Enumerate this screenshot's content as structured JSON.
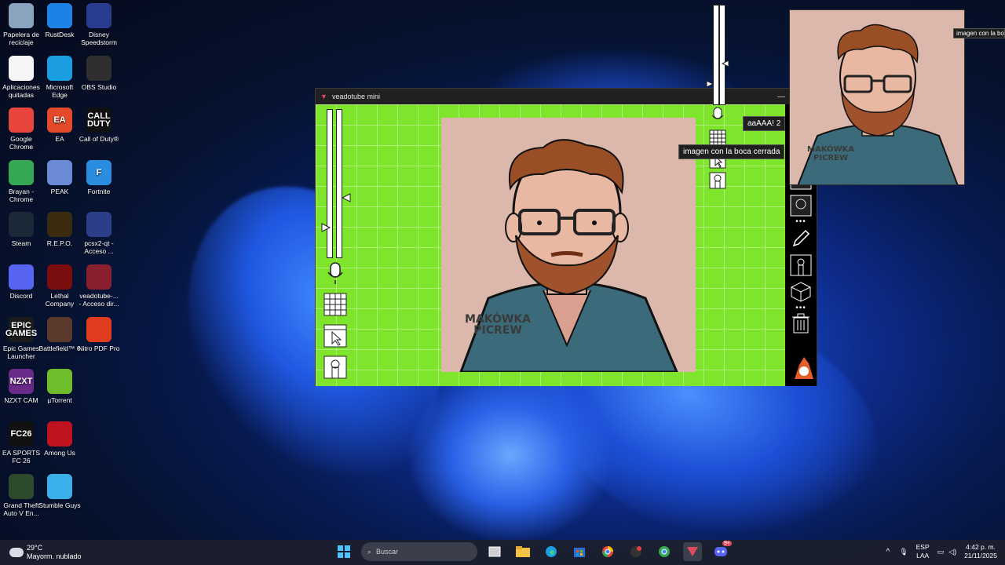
{
  "desktop": {
    "icons": [
      {
        "label": "Papelera de reciclaje",
        "icon": "recycle-bin-icon",
        "color": "#8aa4c0"
      },
      {
        "label": "RustDesk",
        "icon": "rustdesk-icon",
        "color": "#1d82e6"
      },
      {
        "label": "Disney Speedstorm",
        "icon": "disney-speedstorm-icon",
        "color": "#2a3c8f"
      },
      {
        "label": "Aplicaciones quitadas",
        "icon": "chrome-icon",
        "color": "#f5f5f5"
      },
      {
        "label": "Microsoft Edge",
        "icon": "edge-icon",
        "color": "#1b9de2"
      },
      {
        "label": "OBS Studio",
        "icon": "obs-icon",
        "color": "#302e31"
      },
      {
        "label": "Google Chrome",
        "icon": "chrome-icon",
        "color": "#e8453c"
      },
      {
        "label": "EA",
        "icon": "ea-icon",
        "color": "#e24a2a"
      },
      {
        "label": "Call of Duty®",
        "icon": "cod-icon",
        "color": "#111111"
      },
      {
        "label": "Brayan - Chrome",
        "icon": "chrome-profile-icon",
        "color": "#34a853"
      },
      {
        "label": "PEAK",
        "icon": "peak-icon",
        "color": "#6b8bd6"
      },
      {
        "label": "Fortnite",
        "icon": "fortnite-icon",
        "color": "#2b8de0"
      },
      {
        "label": "Steam",
        "icon": "steam-icon",
        "color": "#1b2838"
      },
      {
        "label": "R.E.P.O.",
        "icon": "repo-icon",
        "color": "#3a2a10"
      },
      {
        "label": "pcsx2-qt - Acceso ...",
        "icon": "pcsx2-icon",
        "color": "#2c3e8a"
      },
      {
        "label": "Discord",
        "icon": "discord-icon",
        "color": "#5865f2"
      },
      {
        "label": "Lethal Company",
        "icon": "lethal-company-icon",
        "color": "#7a0d0d"
      },
      {
        "label": "veadotube-... - Acceso dir...",
        "icon": "veadotube-icon",
        "color": "#8a1f2f"
      },
      {
        "label": "Epic Games Launcher",
        "icon": "epic-games-icon",
        "color": "#1c1c1c"
      },
      {
        "label": "Battlefield™ 6",
        "icon": "battlefield-icon",
        "color": "#5a3a2a"
      },
      {
        "label": "Nitro PDF Pro",
        "icon": "nitro-pdf-icon",
        "color": "#e23c1e"
      },
      {
        "label": "NZXT CAM",
        "icon": "nzxt-icon",
        "color": "#6a2a8a"
      },
      {
        "label": "µTorrent",
        "icon": "utorrent-icon",
        "color": "#6fbd2a"
      },
      {
        "label": "EA SPORTS FC 26",
        "icon": "fc26-icon",
        "color": "#111111"
      },
      {
        "label": "Among Us",
        "icon": "among-us-icon",
        "color": "#c1121f"
      },
      {
        "label": "Grand Theft Auto V En...",
        "icon": "gta5-icon",
        "color": "#2d4a2d"
      },
      {
        "label": "Stumble Guys",
        "icon": "stumble-guys-icon",
        "color": "#3bb0e8"
      }
    ],
    "icon_short": [
      "",
      "",
      "",
      "",
      "",
      "",
      "",
      "EA",
      "CALL DUTY",
      "",
      "",
      "F",
      "",
      "",
      "",
      "",
      "",
      "",
      "EPIC GAMES",
      "",
      "",
      "NZXT",
      "",
      "FC26",
      "",
      "",
      ""
    ]
  },
  "veadotube": {
    "title": "veadotube mini",
    "stage_color": "#7ee42c",
    "avatar_watermark_line1": "MAKÓWKA",
    "avatar_watermark_line2": "PICREW"
  },
  "tooltips": {
    "state_name": "aaAAA! 2",
    "closed_mouth": "imagen con la boca cerrada",
    "closed_mouth_right": "imagen con la boca c"
  },
  "preview": {
    "watermark_line1": "MAKÓWKA",
    "watermark_line2": "PICREW"
  },
  "taskbar": {
    "weather_temp": "29°C",
    "weather_desc": "Mayorm. nublado",
    "search_placeholder": "Buscar",
    "lang_line1": "ESP",
    "lang_line2": "LAA",
    "time": "4:42 p. m.",
    "date": "21/11/2025",
    "discord_badge": "9+"
  }
}
